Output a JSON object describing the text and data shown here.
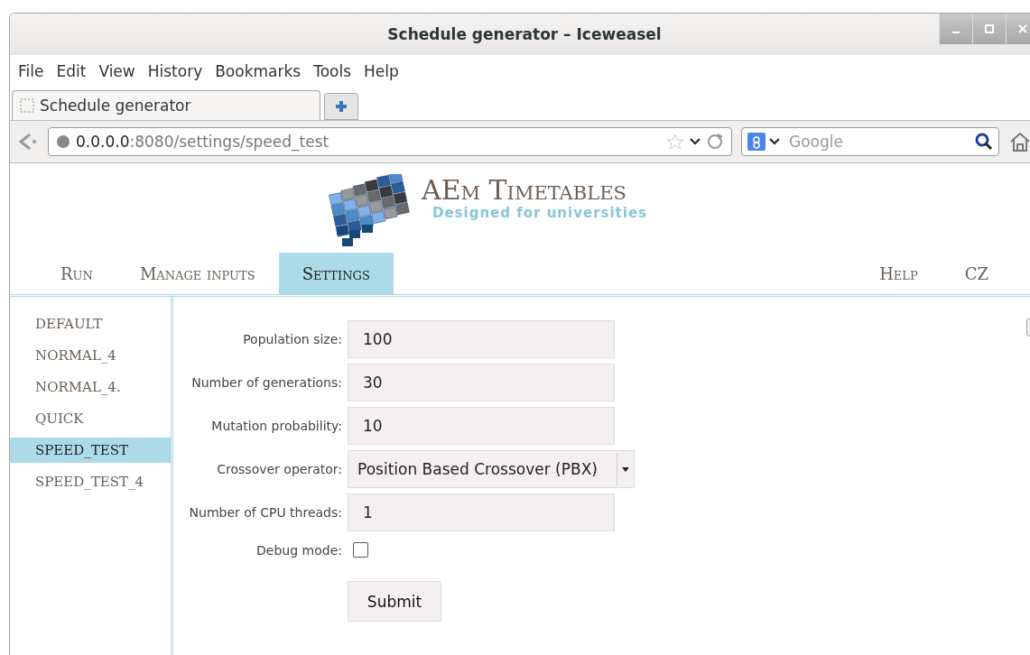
{
  "window": {
    "title": "Schedule generator – Iceweasel"
  },
  "menu": [
    "File",
    "Edit",
    "View",
    "History",
    "Bookmarks",
    "Tools",
    "Help"
  ],
  "tabs": [
    {
      "label": "Schedule generator",
      "selected": true
    }
  ],
  "address": {
    "host": "0.0.0.0",
    "rest": ":8080/settings/speed_test"
  },
  "search": {
    "placeholder": "Google"
  },
  "site": {
    "title": "AEm Timetables",
    "tagline": "Designed for universities"
  },
  "nav": {
    "left": [
      {
        "label": "Run",
        "selected": false
      },
      {
        "label": "Manage inputs",
        "selected": false
      },
      {
        "label": "Settings",
        "selected": true
      }
    ],
    "right": [
      {
        "label": "Help",
        "selected": false
      },
      {
        "label": "CZ",
        "selected": false
      }
    ]
  },
  "sidebar": {
    "items": [
      {
        "label": "DEFAULT",
        "selected": false
      },
      {
        "label": "NORMAL_4",
        "selected": false
      },
      {
        "label": "NORMAL_4.",
        "selected": false
      },
      {
        "label": "QUICK",
        "selected": false
      },
      {
        "label": "SPEED_TEST",
        "selected": true
      },
      {
        "label": "SPEED_TEST_4",
        "selected": false
      }
    ]
  },
  "form": {
    "fields": [
      {
        "kind": "text",
        "label": "Population size:",
        "value": "100"
      },
      {
        "kind": "text",
        "label": "Number of generations:",
        "value": "30"
      },
      {
        "kind": "text",
        "label": "Mutation probability:",
        "value": "10"
      },
      {
        "kind": "select",
        "label": "Crossover operator:",
        "value": "Position Based Crossover (PBX)"
      },
      {
        "kind": "text",
        "label": "Number of CPU threads:",
        "value": "1"
      },
      {
        "kind": "checkbox",
        "label": "Debug mode:",
        "checked": false
      }
    ],
    "submit": "Submit"
  }
}
